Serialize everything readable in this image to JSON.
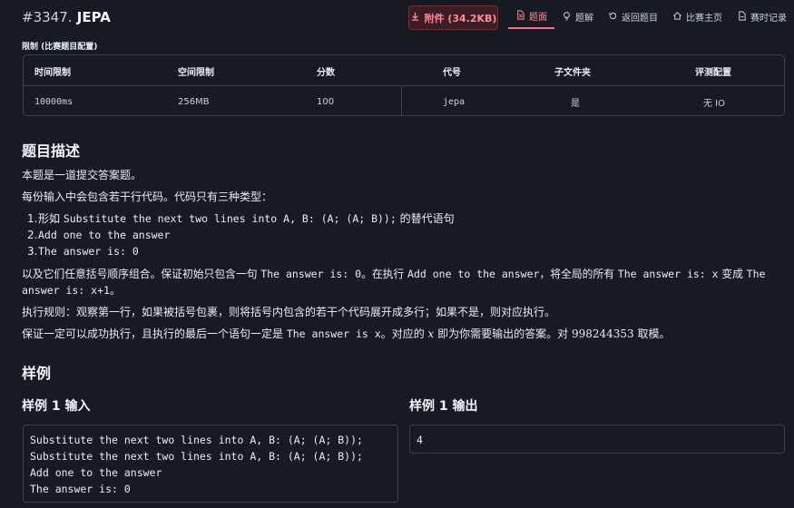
{
  "header": {
    "problem_number": "#3347.",
    "problem_name": "JEPA",
    "attachment_label": "附件 (34.2KB)",
    "nav": [
      {
        "label": "题面",
        "icon": "document-icon",
        "active": true
      },
      {
        "label": "题解",
        "icon": "lightbulb-icon",
        "active": false
      },
      {
        "label": "返回题目",
        "icon": "return-icon",
        "active": false
      },
      {
        "label": "比赛主页",
        "icon": "home-icon",
        "active": false
      },
      {
        "label": "赛时记录",
        "icon": "record-icon",
        "active": false
      }
    ]
  },
  "limits": {
    "label": "限制 (比赛题目配置)",
    "headers": [
      "时间限制",
      "空间限制",
      "分数",
      "代号",
      "子文件夹",
      "评测配置"
    ],
    "values": [
      "10000ms",
      "256MB",
      "100",
      "jepa",
      "是",
      "无 IO"
    ]
  },
  "description": {
    "title": "题目描述",
    "p1": "本题是一道提交答案题。",
    "p2": "每份输入中会包含若干行代码。代码只有三种类型：",
    "items": [
      {
        "num": "1.",
        "pre": "形如 ",
        "code": "Substitute the next two lines into A, B: (A; (A; B));",
        "post": " 的替代语句"
      },
      {
        "num": "2.",
        "pre": "",
        "code": "Add one to the answer",
        "post": ""
      },
      {
        "num": "3.",
        "pre": "",
        "code": "The answer is: 0",
        "post": ""
      }
    ],
    "p3a": "以及它们任意括号顺序组合。保证初始只包含一句 ",
    "p3b": "The answer is: 0",
    "p3c": "。在执行 ",
    "p3d": "Add one to the answer",
    "p3e": "，将全局的所有 ",
    "p3f": "The answer is: x",
    "p3g": " 变成 ",
    "p3h": "The",
    "p3i": "answer is: x+1",
    "p3j": "。",
    "p4": "执行规则：观察第一行，如果被括号包裹，则将括号内包含的若干个代码展开成多行；如果不是，则对应执行。",
    "p5a": "保证一定可以成功执行，且执行的最后一个语句一定是 ",
    "p5b": "The answer is x",
    "p5c": "。对应的 ",
    "p5d": "x",
    "p5e": " 即为你需要输出的答案。对 ",
    "p5f": "998244353",
    "p5g": " 取模。"
  },
  "samples": {
    "title": "样例",
    "input_title": "样例 1 输入",
    "output_title": "样例 1 输出",
    "input_lines": [
      "Substitute the next two lines into A, B: (A; (A; B));",
      "Substitute the next two lines into A, B: (A; (A; B));",
      "Add one to the answer",
      "The answer is: 0"
    ],
    "output_text": "4"
  }
}
